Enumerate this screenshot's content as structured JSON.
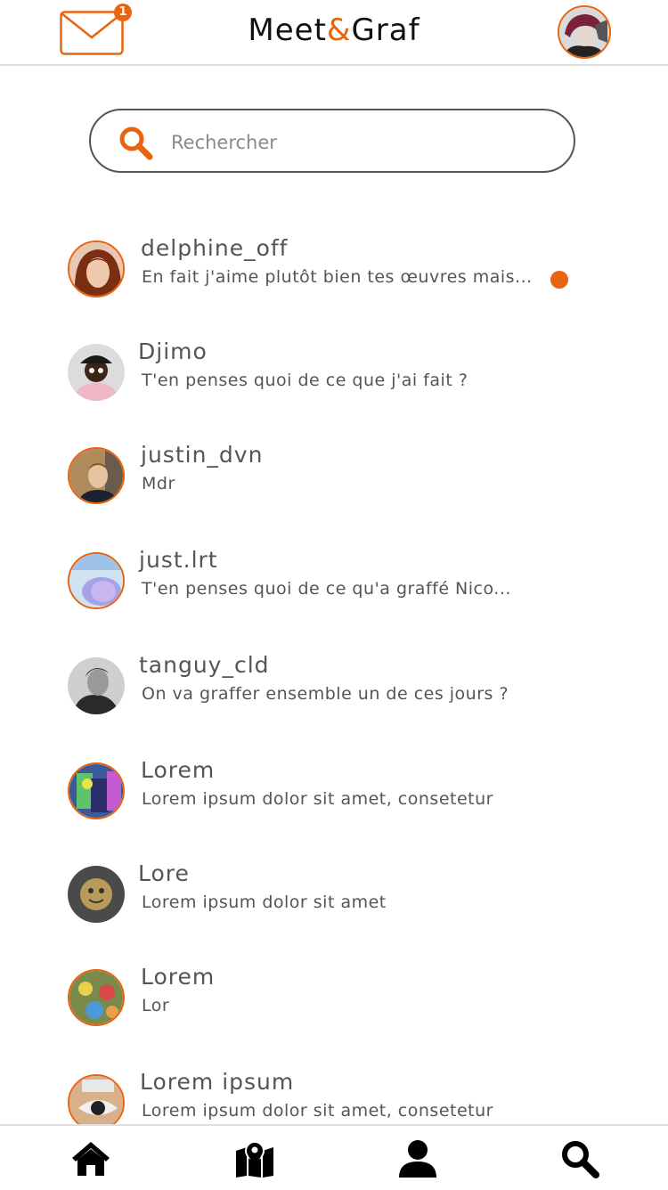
{
  "header": {
    "app_name_part1": "Meet",
    "app_name_amp": "&",
    "app_name_part2": "Graf",
    "mail_badge_count": "1",
    "accent_color": "#e8640e"
  },
  "search": {
    "placeholder": "Rechercher"
  },
  "conversations": [
    {
      "name": "delphine_off",
      "message": "En fait j'aime plutôt bien tes œuvres mais...",
      "unread": true
    },
    {
      "name": "Djimo",
      "message": "T'en penses quoi de ce que j'ai fait ?",
      "unread": false
    },
    {
      "name": "justin_dvn",
      "message": "Mdr",
      "unread": false
    },
    {
      "name": "just.lrt",
      "message": "T'en penses quoi de ce qu'a graffé Nico...",
      "unread": false
    },
    {
      "name": "tanguy_cld",
      "message": "On va graffer ensemble un de ces jours ?",
      "unread": false
    },
    {
      "name": "Lorem",
      "message": "Lorem ipsum dolor sit amet, consetetur",
      "unread": false
    },
    {
      "name": "Lore",
      "message": "Lorem ipsum dolor sit amet",
      "unread": false
    },
    {
      "name": "Lorem",
      "message": "Lor",
      "unread": false
    },
    {
      "name": "Lorem ipsum",
      "message": "Lorem ipsum dolor sit amet, consetetur",
      "unread": false
    }
  ],
  "bottom_nav": [
    "home-icon",
    "map-icon",
    "user-icon",
    "search-icon"
  ]
}
